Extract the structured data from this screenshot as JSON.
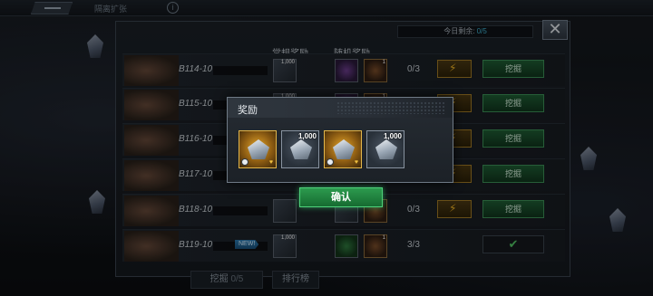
{
  "topbar": {
    "title": "隔离扩张",
    "info_glyph": "i"
  },
  "panel": {
    "remaining_label": "今日剩余:",
    "remaining_value": "0/5",
    "col_regular": "常规奖励",
    "col_random": "随机奖励",
    "close_glyph": "✕",
    "rows": [
      {
        "stage": "B114-10",
        "reg_qty": "1,000",
        "rand_qty": "1",
        "progress": "0/3",
        "action": "挖掘"
      },
      {
        "stage": "B115-10",
        "reg_qty": "1,000",
        "rand_qty": "1",
        "progress": "",
        "action": "挖掘"
      },
      {
        "stage": "B116-10",
        "reg_qty": "",
        "rand_qty": "",
        "progress": "",
        "action": "挖掘"
      },
      {
        "stage": "B117-10",
        "reg_qty": "",
        "rand_qty": "",
        "progress": "",
        "action": "挖掘"
      },
      {
        "stage": "B118-10",
        "reg_qty": "",
        "rand_qty": "",
        "progress": "0/3",
        "action": "挖掘"
      },
      {
        "stage": "B119-10",
        "reg_qty": "1,000",
        "rand_qty": "1",
        "progress": "3/3",
        "action": "✔",
        "badge": "NEW!"
      }
    ],
    "bottom_tabs": {
      "dig": "挖掘",
      "dig_count": "0/5",
      "ranking": "排行榜"
    }
  },
  "popup": {
    "title": "奖励",
    "rewards": [
      {
        "quality": "gold",
        "qty": "",
        "heart": true
      },
      {
        "quality": "grey",
        "qty": "1,000",
        "heart": false
      },
      {
        "quality": "gold",
        "qty": "",
        "heart": true
      },
      {
        "quality": "grey",
        "qty": "1,000",
        "heart": false
      }
    ],
    "confirm": "确认"
  },
  "icons": {
    "heart": "♥",
    "lightning": "⚡",
    "check": "✔"
  },
  "colors": {
    "confirm_green": "#2c9a4e",
    "dig_green": "#1f5c34",
    "gold_frame": "#e3b64a",
    "count_cyan": "#3fb3d1"
  }
}
